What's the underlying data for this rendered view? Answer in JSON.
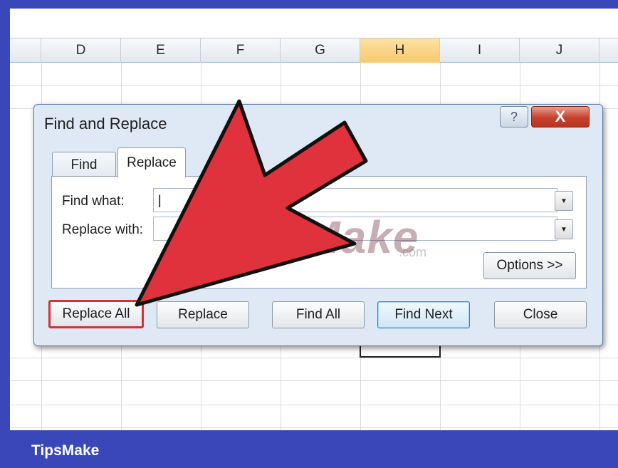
{
  "spreadsheet": {
    "columns": [
      "D",
      "E",
      "F",
      "G",
      "H",
      "I",
      "J"
    ],
    "selected_column": "H"
  },
  "dialog": {
    "title": "Find and Replace",
    "help_icon": "question-mark-icon",
    "close_icon": "close-x-icon",
    "help_glyph": "?",
    "close_glyph": "X",
    "tabs": [
      {
        "label": "Find",
        "active": false
      },
      {
        "label": "Replace",
        "active": true
      }
    ],
    "find_what": {
      "label": "Find what:",
      "value": "|"
    },
    "replace_with": {
      "label": "Replace with:",
      "value": ""
    },
    "dropdown_glyph": "▼",
    "options_button": "Options >>",
    "buttons": {
      "replace_all": "Replace All",
      "replace": "Replace",
      "find_all": "Find All",
      "find_next": "Find Next",
      "close": "Close"
    }
  },
  "watermark": {
    "text": "TipsMake",
    "sub": ".com"
  },
  "footer": {
    "brand": "TipsMake"
  },
  "colors": {
    "frame": "#3a47b8",
    "arrow": "#e0323c",
    "highlight": "#d6303a"
  }
}
